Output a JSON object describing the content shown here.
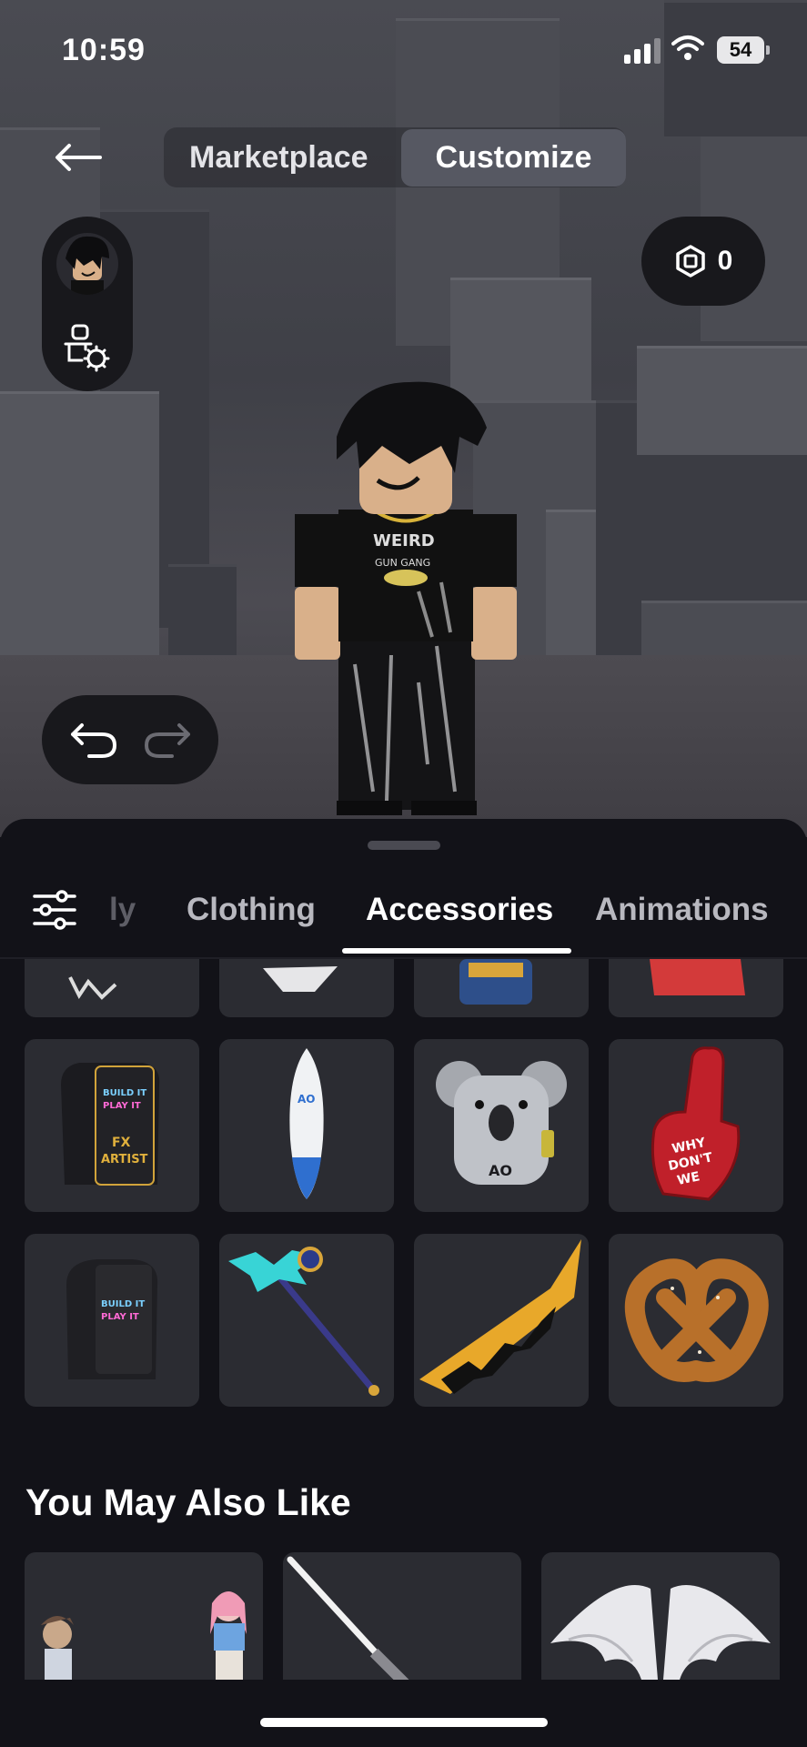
{
  "status_bar": {
    "time": "10:59",
    "battery": "54"
  },
  "header": {
    "tabs": [
      {
        "label": "Marketplace",
        "active": false
      },
      {
        "label": "Customize",
        "active": true
      }
    ]
  },
  "robux": {
    "balance": "0"
  },
  "icons": {
    "back": "arrow-left-icon",
    "avatar_settings": "avatar-settings-gear-icon",
    "robux": "robux-hexagon-icon",
    "undo": "undo-icon",
    "redo": "redo-icon",
    "filter": "sliders-filter-icon"
  },
  "categories": {
    "partial_left": "ly",
    "tabs": [
      {
        "label": "Clothing",
        "active": false
      },
      {
        "label": "Accessories",
        "active": true
      },
      {
        "label": "Animations",
        "active": false
      }
    ]
  },
  "grid_items": [
    {
      "name": "partial-item-1"
    },
    {
      "name": "partial-item-2"
    },
    {
      "name": "partial-item-3"
    },
    {
      "name": "partial-item-4"
    },
    {
      "name": "build-it-fx-artist-backpack",
      "text": "BUILD IT PLAY IT FX ARTIST"
    },
    {
      "name": "ao-surfboard",
      "text": "AO"
    },
    {
      "name": "ao-koala-backpack",
      "text": "AO"
    },
    {
      "name": "why-dont-we-foam-finger",
      "text": "WHY DON'T WE"
    },
    {
      "name": "build-it-play-it-backpack",
      "text": "BUILD IT PLAY IT"
    },
    {
      "name": "crystal-staff"
    },
    {
      "name": "gold-black-blade"
    },
    {
      "name": "pretzel"
    }
  ],
  "recommendations": {
    "title": "You May Also Like",
    "items": [
      {
        "name": "anime-characters"
      },
      {
        "name": "lightsaber"
      },
      {
        "name": "white-wings"
      }
    ]
  },
  "colors": {
    "sheet_bg": "#121218",
    "tile_bg": "#2b2c32",
    "pill_bg": "#18181c",
    "active_tab_bg": "#565862"
  }
}
